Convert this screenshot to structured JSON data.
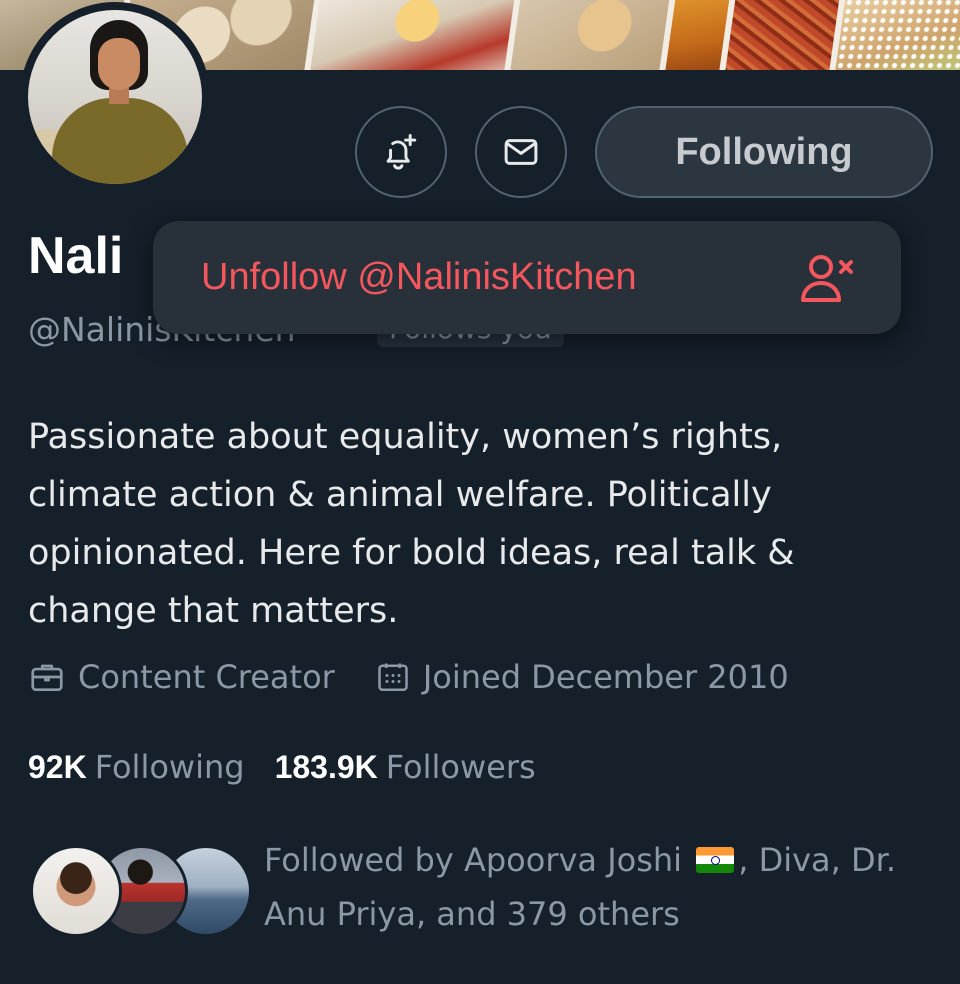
{
  "actions": {
    "following_label": "Following",
    "notify_icon": "bell-plus-icon",
    "message_icon": "envelope-icon"
  },
  "profile": {
    "display_name_visible": "Nali",
    "username_visible": "@NalinisKitchen",
    "follows_you_badge": "Follows you",
    "bio_lines": [
      "Passionate about equality, women’s rights,",
      "climate action & animal welfare. Politically",
      "opinionated. Here for bold ideas, real talk &",
      "change that matters."
    ],
    "category": "Content Creator",
    "category_icon": "briefcase-icon",
    "joined": "Joined December 2010",
    "joined_icon": "calendar-icon"
  },
  "stats": {
    "following_count": "92K",
    "following_label": "Following",
    "followers_count": "183.9K",
    "followers_label": "Followers"
  },
  "unfollow_menu": {
    "label": "Unfollow @NalinisKitchen",
    "icon": "user-remove-icon"
  },
  "followed_by": {
    "line1_prefix": "Followed by Apoorva Joshi",
    "line1_suffix": ", Diva, Dr.",
    "line2": "Anu Priya, and 379 others"
  },
  "colors": {
    "background": "#15202b",
    "danger": "#f4575e",
    "secondary_text": "#8b98a5"
  }
}
